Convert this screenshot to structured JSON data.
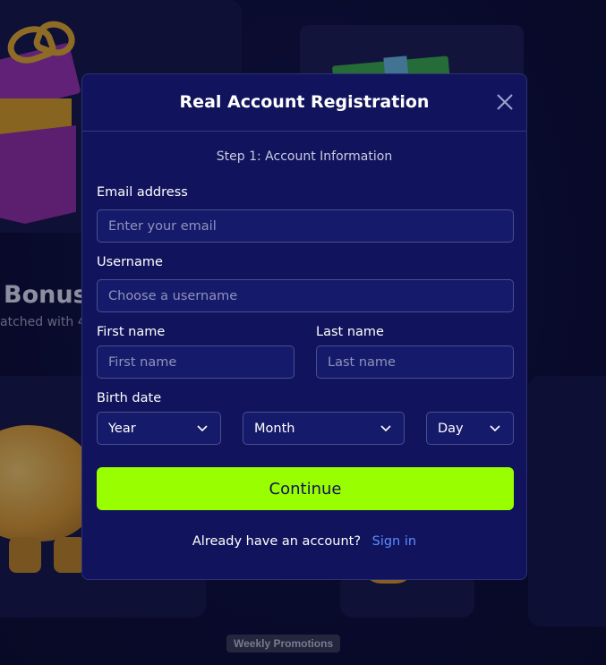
{
  "background": {
    "bonus_title": "Bonus",
    "bonus_subtitle": "atched with 4",
    "weekly_promotions": "Weekly Promotions"
  },
  "modal": {
    "title": "Real Account Registration",
    "close_icon": "close-icon",
    "step_text": "Step 1: Account Information",
    "email": {
      "label": "Email address",
      "placeholder": "Enter your email"
    },
    "username": {
      "label": "Username",
      "placeholder": "Choose a username"
    },
    "first_name": {
      "label": "First name",
      "placeholder": "First name"
    },
    "last_name": {
      "label": "Last name",
      "placeholder": "Last name"
    },
    "birth_date": {
      "label": "Birth date",
      "year": "Year",
      "month": "Month",
      "day": "Day"
    },
    "continue_label": "Continue",
    "signin_prompt": "Already have an account?",
    "signin_link": "Sign in"
  },
  "colors": {
    "accent_button": "#99ff00",
    "link": "#5b8cff",
    "modal_bg": "#11145c",
    "page_bg": "#0c0d38"
  }
}
